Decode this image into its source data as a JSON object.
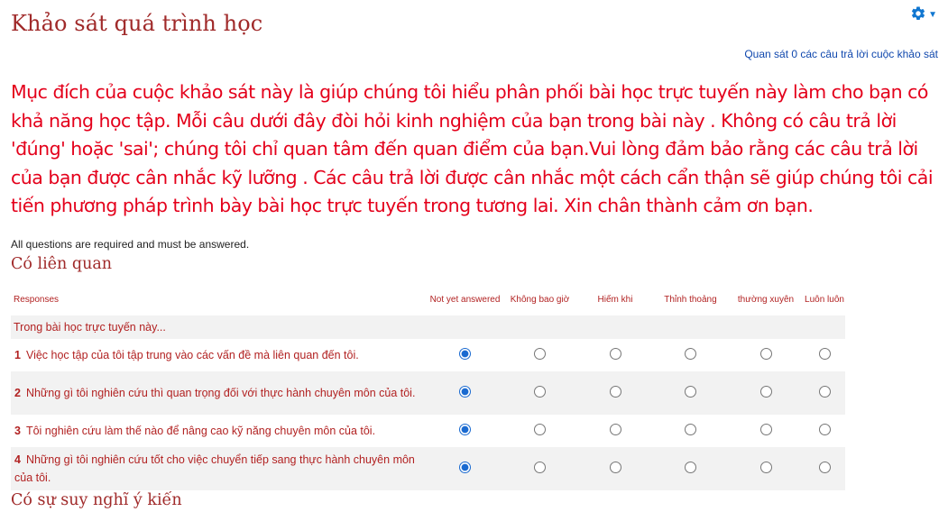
{
  "title": "Khảo sát quá trình học",
  "view_responses_link": "Quan sát 0 các câu trả lời cuộc khảo sát",
  "intro": "Mục đích của cuộc khảo sát này là giúp chúng tôi hiểu phân phối bài học trực tuyến này làm cho bạn có khả năng học tập. Mỗi câu dưới đây đòi hỏi kinh nghiệm của bạn trong bài này . Không có câu trả lời 'đúng' hoặc 'sai'; chúng tôi chỉ quan tâm đến quan điểm của bạn.Vui lòng đảm bảo rằng các câu trả lời của bạn được cân nhắc kỹ lưỡng . Các câu trả lời được cân nhắc một cách cẩn thận sẽ giúp chúng tôi cải tiến phương pháp trình bày bài học trực tuyến trong tương lai. Xin chân thành cảm ơn bạn.",
  "required_note": "All questions are required and must be answered.",
  "settings_icon": "gear-icon",
  "colors": {
    "accent": "#1177d1",
    "title": "#a02a2a",
    "intro": "#e4001b"
  },
  "sections": [
    {
      "title": "Có liên quan",
      "columns": {
        "responses": "Responses",
        "not_yet": "Not yet answered",
        "options": [
          "Không bao giờ",
          "Hiếm khi",
          "Thỉnh thoảng",
          "thường xuyên",
          "Luôn luôn"
        ]
      },
      "group_label": "Trong bài học trực tuyến này...",
      "questions": [
        {
          "num": "1",
          "text": "Việc học tập của tôi tập trung vào các vấn đề mà liên quan đến tôi.",
          "selected": "not_yet"
        },
        {
          "num": "2",
          "text": "Những gì tôi nghiên cứu thì quan trọng đối với thực hành chuyên môn của tôi.",
          "selected": "not_yet"
        },
        {
          "num": "3",
          "text": "Tôi nghiên cứu làm thế nào để nâng cao kỹ năng chuyên môn của tôi.",
          "selected": "not_yet"
        },
        {
          "num": "4",
          "text": "Những gì tôi nghiên cứu tốt cho việc chuyển tiếp sang thực hành chuyên môn của tôi.",
          "selected": "not_yet"
        }
      ]
    },
    {
      "title": "Có sự suy nghĩ ý kiến"
    }
  ]
}
